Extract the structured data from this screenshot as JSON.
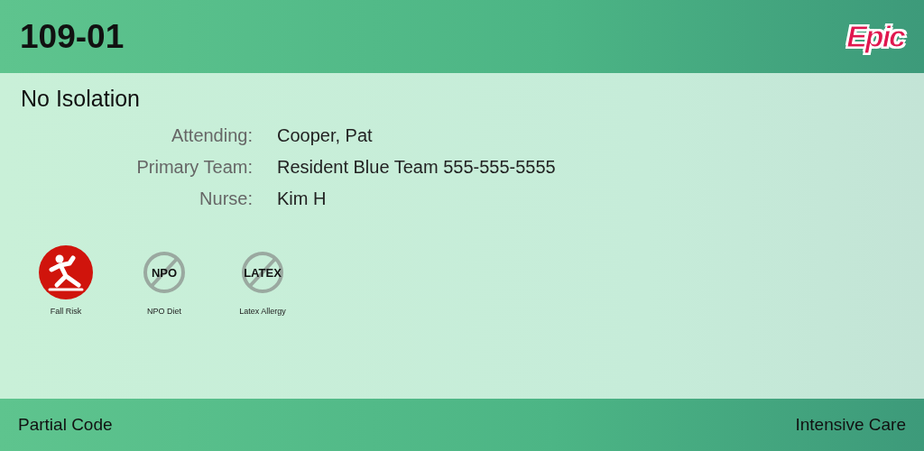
{
  "header": {
    "room": "109-01",
    "logo": "Epic"
  },
  "isolation": "No Isolation",
  "care_team": [
    {
      "label": "Attending:",
      "value": "Cooper, Pat"
    },
    {
      "label": "Primary Team:",
      "value": "Resident Blue Team 555-555-5555"
    },
    {
      "label": "Nurse:",
      "value": "Kim H"
    }
  ],
  "alerts": [
    {
      "kind": "fall",
      "active": true,
      "label": "Fall Risk"
    },
    {
      "kind": "prohibited",
      "active": false,
      "badge": "NPO",
      "label": "NPO Diet"
    },
    {
      "kind": "prohibited",
      "active": false,
      "badge": "LATEX",
      "label": "Latex Allergy"
    }
  ],
  "footer": {
    "code_status": "Partial Code",
    "unit": "Intensive Care"
  }
}
